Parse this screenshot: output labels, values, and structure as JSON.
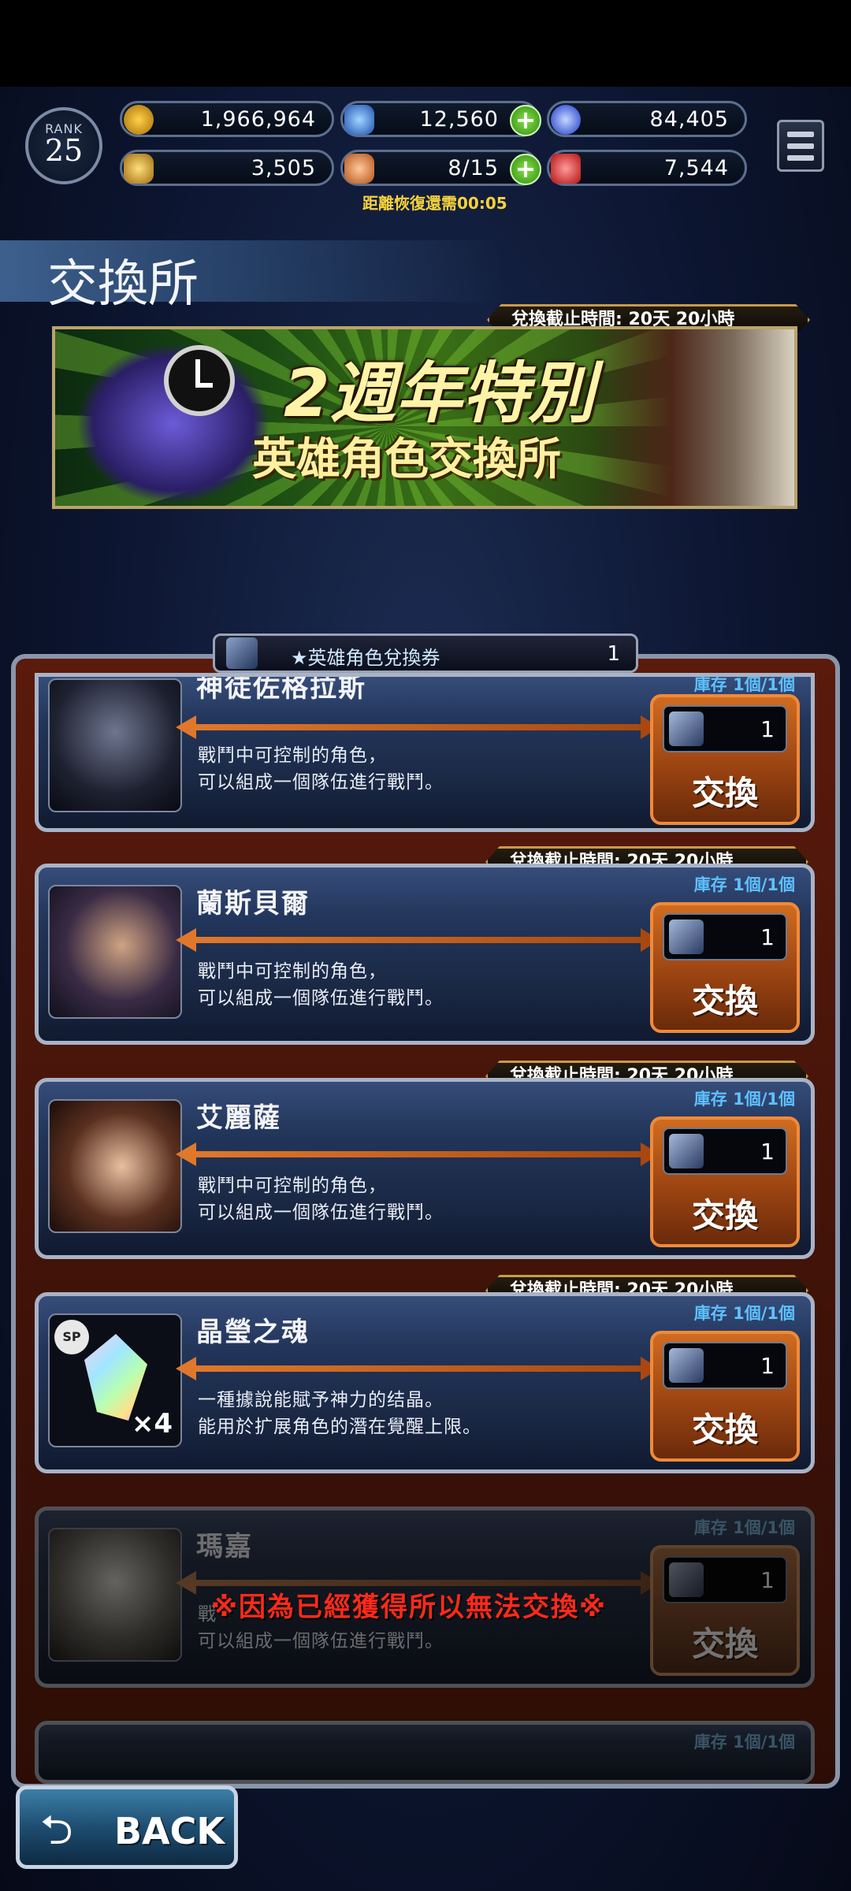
{
  "hud": {
    "rank_label": "RANK",
    "rank_value": "25",
    "gil": "1,966,964",
    "crystals": "12,560",
    "orbs": "84,405",
    "trophies": "3,505",
    "stamina": "8/15",
    "red_currency": "7,544",
    "recovery_text": "距離恢復還需00:05"
  },
  "page_title": "交換所",
  "banner": {
    "deadline": "兌換截止時間:  20天 20小時",
    "title_line1": "2週年特別",
    "title_line2": "英雄角色交換所"
  },
  "ticket": {
    "name": "★英雄角色兌換券",
    "count": "1"
  },
  "items": [
    {
      "name": "神徒佐格拉斯",
      "desc1": "戰鬥中可控制的角色，",
      "desc2": "可以組成一個隊伍進行戰鬥。",
      "stock": "庫存 1個/1個",
      "cost": "1",
      "button": "交換"
    },
    {
      "deadline": "兌換截止時間:  20天 20小時",
      "name": "蘭斯貝爾",
      "desc1": "戰鬥中可控制的角色，",
      "desc2": "可以組成一個隊伍進行戰鬥。",
      "stock": "庫存 1個/1個",
      "cost": "1",
      "button": "交換"
    },
    {
      "deadline": "兌換截止時間:  20天 20小時",
      "name": "艾麗薩",
      "desc1": "戰鬥中可控制的角色，",
      "desc2": "可以組成一個隊伍進行戰鬥。",
      "stock": "庫存 1個/1個",
      "cost": "1",
      "button": "交換"
    },
    {
      "deadline": "兌換截止時間:  20天 20小時",
      "name": "晶瑩之魂",
      "desc1": "一種據說能賦予神力的结晶。",
      "desc2": "能用於扩展角色的潛在覺醒上限。",
      "stock": "庫存 1個/1個",
      "cost": "1",
      "button": "交換",
      "badge": "SP",
      "quantity": "×4"
    },
    {
      "name": "瑪嘉",
      "desc1": "戰",
      "desc2": "可以組成一個隊伍進行戰鬥。",
      "stock": "庫存 1個/1個",
      "cost": "1",
      "button": "交換",
      "warning": "※因為已經獲得所以無法交換※"
    },
    {
      "stock": "庫存 1個/1個"
    }
  ],
  "back_button": "BACK"
}
